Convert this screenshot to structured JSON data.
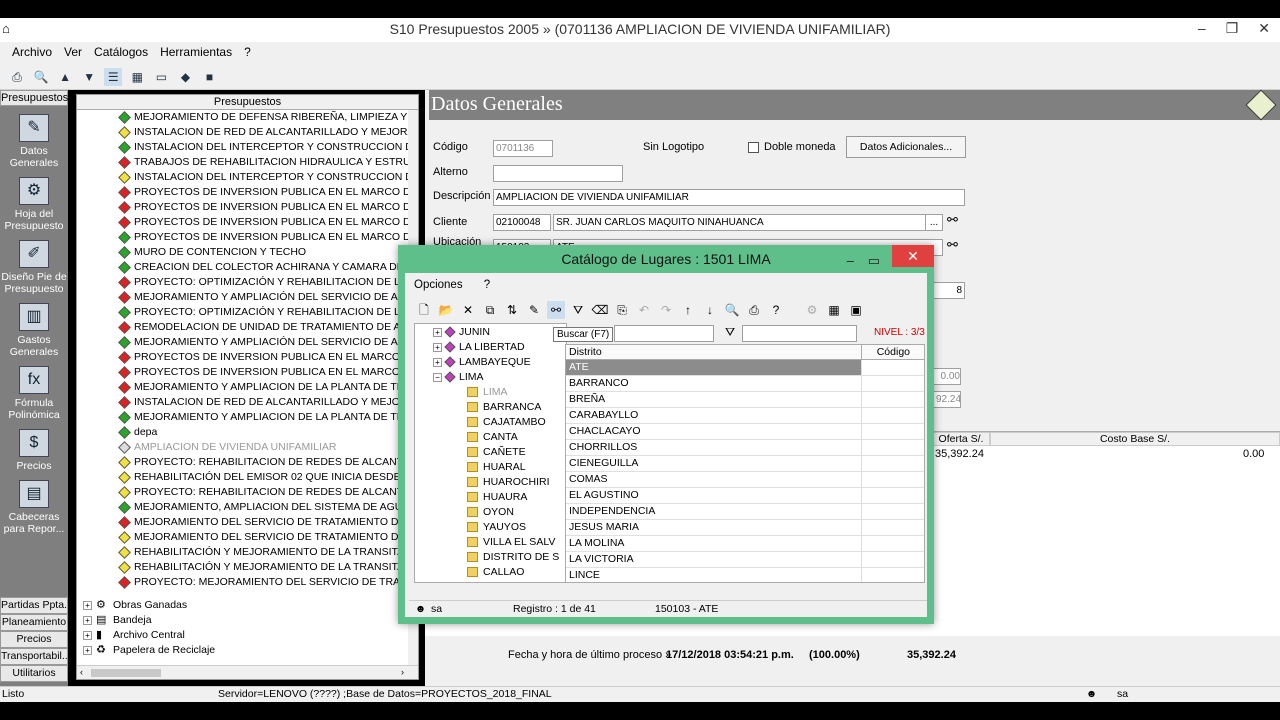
{
  "window": {
    "title": "S10 Presupuestos 2005 » (0701136 AMPLIACION DE VIVIENDA UNIFAMILIAR)",
    "min": "–",
    "restore": "❐",
    "close": "✕"
  },
  "menu": [
    "Archivo",
    "Ver",
    "Catálogos",
    "Herramientas",
    "?"
  ],
  "leftbar": {
    "header": "Presupuestos",
    "items": [
      {
        "label": "Datos Generales",
        "icon": "✎"
      },
      {
        "label": "Hoja del Presupuesto",
        "icon": "⚙"
      },
      {
        "label": "Diseño Pie de Presupuesto",
        "icon": "✐"
      },
      {
        "label": "Gastos Generales",
        "icon": "▥"
      },
      {
        "label": "Fórmula Polinómica",
        "icon": "fx"
      },
      {
        "label": "Precios",
        "icon": "$"
      },
      {
        "label": "Cabeceras para Repor...",
        "icon": "▤"
      }
    ],
    "bottom": [
      "Partidas Ppta.",
      "Planeamiento",
      "Precios",
      "Transportabil...",
      "Utilitarios"
    ]
  },
  "tree": {
    "header": "Presupuestos",
    "items": [
      {
        "c": "green",
        "t": "MEJORAMIENTO DE DEFENSA RIBEREÑA, LIMPIEZA Y DESCO"
      },
      {
        "c": "yellow",
        "t": "INSTALACION DE RED DE ALCANTARILLADO Y MEJORAMIE"
      },
      {
        "c": "green",
        "t": "INSTALACION DEL INTERCEPTOR Y CONSTRUCCION DE LA I"
      },
      {
        "c": "red",
        "t": "TRABAJOS DE REHABILITACION HIDRAULICA Y ESTRUCTUF"
      },
      {
        "c": "yellow",
        "t": "INSTALACION DEL INTERCEPTOR Y CONSTRUCCION DE LA I"
      },
      {
        "c": "red",
        "t": "PROYECTOS DE INVERSION PUBLICA EN EL MARCO DEL SIS"
      },
      {
        "c": "red",
        "t": "PROYECTOS DE INVERSION PUBLICA EN EL MARCO DEL SIS"
      },
      {
        "c": "red",
        "t": "PROYECTOS DE INVERSION PUBLICA EN EL MARCO DEL SIS"
      },
      {
        "c": "green",
        "t": "PROYECTOS DE INVERSION PUBLICA EN EL MARCO DEL SIS"
      },
      {
        "c": "green",
        "t": "MURO DE CONTENCION Y TECHO"
      },
      {
        "c": "green",
        "t": "CREACION DEL COLECTOR ACHIRANA Y CAMARA DE BOI"
      },
      {
        "c": "red",
        "t": "PROYECTO: OPTIMIZACIÓN Y REHABILITACION DE LA PLA"
      },
      {
        "c": "red",
        "t": "MEJORAMIENTO Y AMPLIACIÓN DEL SERVICIO DE AGUA F"
      },
      {
        "c": "green",
        "t": "PROYECTO: OPTIMIZACIÓN Y REHABILITACION DE LA PLA"
      },
      {
        "c": "red",
        "t": "REMODELACION DE UNIDAD DE TRATAMIENTO DE AGUA F"
      },
      {
        "c": "green",
        "t": "MEJORAMIENTO Y AMPLIACIÓN DEL SERVICIO DE AGUA F"
      },
      {
        "c": "red",
        "t": "PROYECTOS DE INVERSION PUBLICA EN EL MARCO DEL S"
      },
      {
        "c": "red",
        "t": "PROYECTOS DE INVERSION PUBLICA EN EL MARCO DEL S"
      },
      {
        "c": "red",
        "t": "MEJORAMIENTO Y AMPLIACION DE LA PLANTA DE TRATAI"
      },
      {
        "c": "red",
        "t": "INSTALACION DE RED DE ALCANTARILLADO Y MEJORAM"
      },
      {
        "c": "green",
        "t": "MEJORAMIENTO Y AMPLIACION DE LA PLANTA DE TRATAI"
      },
      {
        "c": "green",
        "t": "depa"
      },
      {
        "c": "gray",
        "t": "AMPLIACION DE VIVIENDA UNIFAMILIAR",
        "sel": true
      },
      {
        "c": "yellow",
        "t": "PROYECTO: REHABILITACION DE REDES DE ALCANTARIL"
      },
      {
        "c": "yellow",
        "t": "REHABILITACIÓN DEL EMISOR 02 QUE INICIA DESDE LA IN"
      },
      {
        "c": "yellow",
        "t": "PROYECTO: REHABILITACION DE REDES DE ALCANTARIL"
      },
      {
        "c": "green",
        "t": "MEJORAMIENTO, AMPLIACION DEL SISTEMA DE AGUA POT"
      },
      {
        "c": "red",
        "t": "MEJORAMIENTO DEL SERVICIO DE TRATAMIENTO DE AGU"
      },
      {
        "c": "yellow",
        "t": "MEJORAMIENTO DEL SERVICIO DE TRATAMIENTO DE AGU"
      },
      {
        "c": "yellow",
        "t": "REHABILITACIÓN Y MEJORAMIENTO DE LA TRANSITABILI"
      },
      {
        "c": "yellow",
        "t": "REHABILITACIÓN Y MEJORAMIENTO DE LA TRANSITABILI"
      },
      {
        "c": "red",
        "t": "PROYECTO: MEJORAMIENTO DEL SERVICIO DE TRATAMIE"
      }
    ],
    "roots": [
      "Obras Ganadas",
      "Bandeja",
      "Archivo Central",
      "Papelera de Reciclaje"
    ]
  },
  "main": {
    "header": "Datos Generales",
    "codigo_lbl": "Código",
    "codigo": "0701136",
    "alterno_lbl": "Alterno",
    "sin_logotipo": "Sin Logotipo",
    "doble_moneda": "Doble moneda",
    "datos_adicionales": "Datos Adicionales...",
    "descripcion_lbl": "Descripción",
    "descripcion": "AMPLIACION DE VIVIENDA UNIFAMILIAR",
    "cliente_lbl": "Cliente",
    "cliente_code": "02100048",
    "cliente_name": "SR. JUAN CARLOS MAQUITO NINAHUANCA",
    "ubicacion_lbl": "Ubicación",
    "ubicacion_code": "150103",
    "ubicacion_name": "ATE",
    "ellipsis": "...",
    "side_value": "8",
    "val_a": "0.00",
    "val_b": "92.24",
    "grid_oferta": "Oferta S/.",
    "grid_costo": "Costo Base S/.",
    "oferta_val": "35,392.24",
    "costo_val": "0.00",
    "fecha_lbl": "Fecha y hora de último proceso »",
    "fecha_val": "17/12/2018 03:54:21 p.m.",
    "pct": "(100.00%)",
    "total": "35,392.24"
  },
  "dialog": {
    "title": "Catálogo de Lugares  : 1501  LIMA",
    "menu": "Opciones",
    "menu_help": "?",
    "tooltip": "Buscar (F7)",
    "nivel": "NIVEL : 3/3",
    "tree": [
      {
        "t": "JUNIN",
        "lvl": 0,
        "type": "dept"
      },
      {
        "t": "LA LIBERTAD",
        "lvl": 0,
        "type": "dept"
      },
      {
        "t": "LAMBAYEQUE",
        "lvl": 0,
        "type": "dept"
      },
      {
        "t": "LIMA",
        "lvl": 0,
        "type": "open"
      },
      {
        "t": "LIMA",
        "lvl": 1,
        "type": "folder",
        "sel": true
      },
      {
        "t": "BARRANCA",
        "lvl": 1,
        "type": "folder"
      },
      {
        "t": "CAJATAMBO",
        "lvl": 1,
        "type": "folder"
      },
      {
        "t": "CANTA",
        "lvl": 1,
        "type": "folder"
      },
      {
        "t": "CAÑETE",
        "lvl": 1,
        "type": "folder"
      },
      {
        "t": "HUARAL",
        "lvl": 1,
        "type": "folder"
      },
      {
        "t": "HUAROCHIRI",
        "lvl": 1,
        "type": "folder"
      },
      {
        "t": "HUAURA",
        "lvl": 1,
        "type": "folder"
      },
      {
        "t": "OYON",
        "lvl": 1,
        "type": "folder"
      },
      {
        "t": "YAUYOS",
        "lvl": 1,
        "type": "folder"
      },
      {
        "t": "VILLA EL SALV",
        "lvl": 1,
        "type": "folder"
      },
      {
        "t": "DISTRITO DE S",
        "lvl": 1,
        "type": "folder"
      },
      {
        "t": "CALLAO",
        "lvl": 1,
        "type": "folder"
      }
    ],
    "col_distrito": "Distrito",
    "col_codigo": "Código",
    "rows": [
      "ATE",
      "BARRANCO",
      "BREÑA",
      "CARABAYLLO",
      "CHACLACAYO",
      "CHORRILLOS",
      "CIENEGUILLA",
      "COMAS",
      "EL AGUSTINO",
      "INDEPENDENCIA",
      "JESUS MARIA",
      "LA MOLINA",
      "LA VICTORIA",
      "LINCE"
    ],
    "status_user": "sa",
    "status_registro": "Registro :  1 de  41",
    "status_sel": "150103 - ATE"
  },
  "status": {
    "left": "Listo",
    "server": "Servidor=LENOVO (????) ;Base de Datos=PROYECTOS_2018_FINAL",
    "user": "sa"
  }
}
